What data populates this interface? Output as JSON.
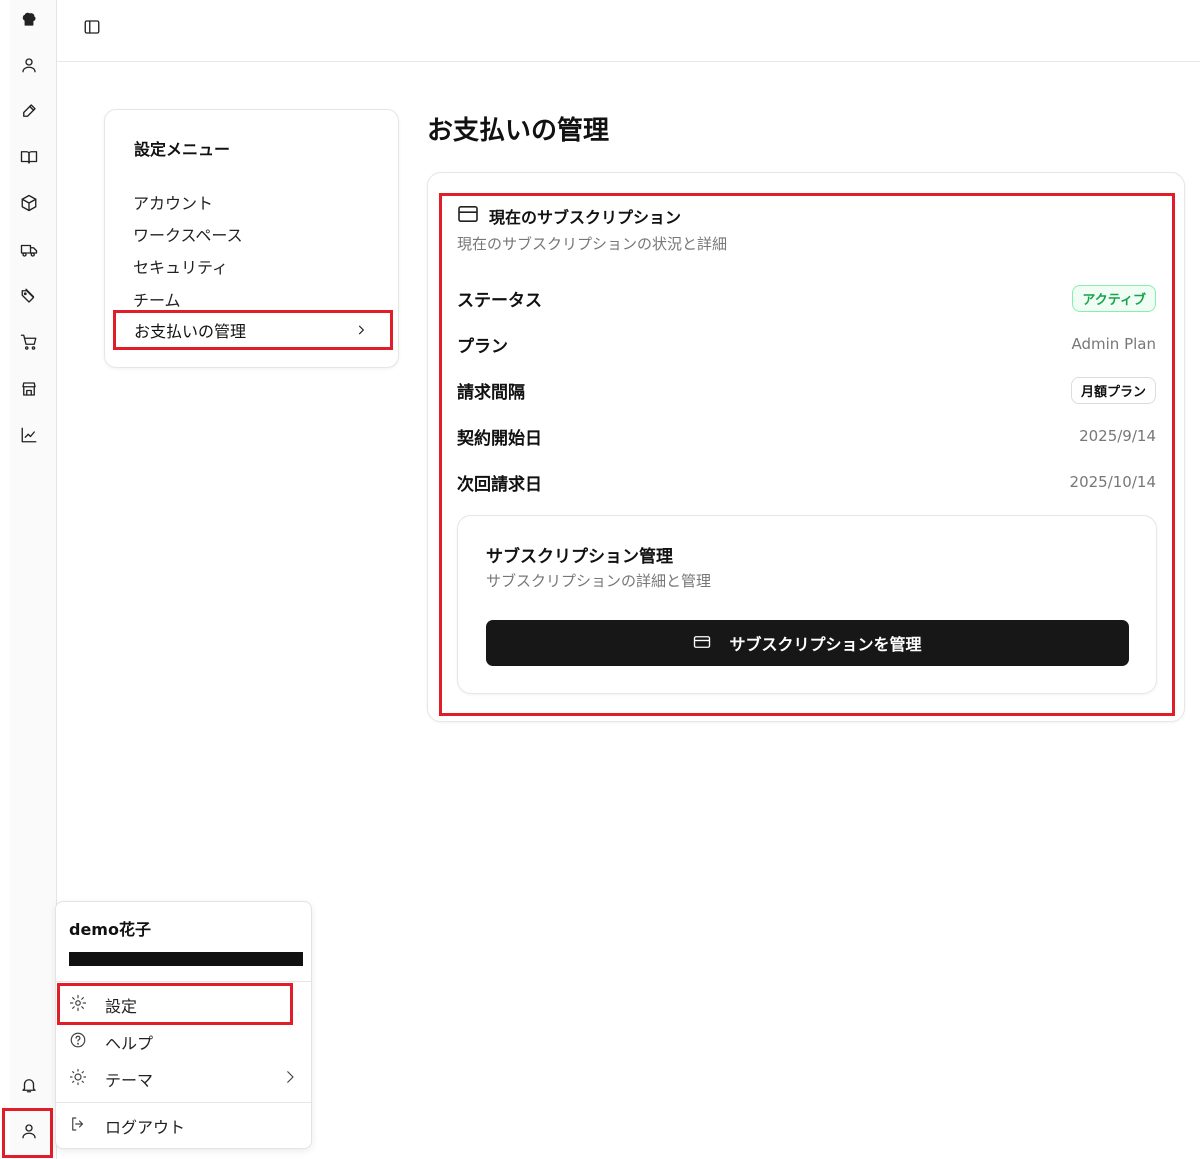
{
  "sidebar": {
    "icons": [
      "logo-icon",
      "user-icon",
      "pen-icon",
      "book-icon",
      "package-icon",
      "truck-icon",
      "tags-icon",
      "cart-icon",
      "store-icon",
      "chart-icon"
    ],
    "bottom_icons": [
      "bell-icon",
      "user-icon"
    ]
  },
  "settings_menu": {
    "title": "設定メニュー",
    "items": [
      "アカウント",
      "ワークスペース",
      "セキュリティ",
      "チーム",
      "お支払いの管理"
    ]
  },
  "page": {
    "title": "お支払いの管理"
  },
  "subscription": {
    "title": "現在のサブスクリプション",
    "description": "現在のサブスクリプションの状況と詳細",
    "rows": [
      {
        "label": "ステータス",
        "value": "アクティブ"
      },
      {
        "label": "プラン",
        "value": "Admin Plan"
      },
      {
        "label": "請求間隔",
        "value": "月額プラン"
      },
      {
        "label": "契約開始日",
        "value": "2025/9/14"
      },
      {
        "label": "次回請求日",
        "value": "2025/10/14"
      }
    ],
    "management": {
      "title": "サブスクリプション管理",
      "description": "サブスクリプションの詳細と管理",
      "button_label": "サブスクリプションを管理"
    }
  },
  "user_menu": {
    "name": "demo花子",
    "items": [
      "設定",
      "ヘルプ",
      "テーマ",
      "ログアウト"
    ]
  },
  "colors": {
    "highlight": "#e11d2a",
    "active_badge": "#16a34a",
    "button_bg": "#171717"
  }
}
